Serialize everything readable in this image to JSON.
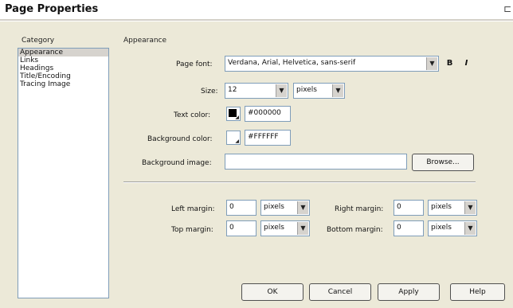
{
  "window": {
    "title": "Page Properties"
  },
  "category": {
    "header": "Category",
    "items": [
      {
        "label": "Appearance",
        "selected": true
      },
      {
        "label": "Links"
      },
      {
        "label": "Headings"
      },
      {
        "label": "Title/Encoding"
      },
      {
        "label": "Tracing Image"
      }
    ]
  },
  "appearance": {
    "header": "Appearance",
    "page_font": {
      "label": "Page font:",
      "value": "Verdana, Arial, Helvetica, sans-serif",
      "bold": "B",
      "italic": "I"
    },
    "size": {
      "label": "Size:",
      "value": "12",
      "unit": "pixels"
    },
    "text_color": {
      "label": "Text color:",
      "value": "#000000",
      "swatch": "#000000"
    },
    "background_color": {
      "label": "Background color:",
      "value": "#FFFFFF",
      "swatch": "#FFFFFF"
    },
    "background_image": {
      "label": "Background image:",
      "value": "",
      "browse": "Browse..."
    },
    "left_margin": {
      "label": "Left margin:",
      "value": "0",
      "unit": "pixels"
    },
    "right_margin": {
      "label": "Right margin:",
      "value": "0",
      "unit": "pixels"
    },
    "top_margin": {
      "label": "Top margin:",
      "value": "0",
      "unit": "pixels"
    },
    "bottom_margin": {
      "label": "Bottom margin:",
      "value": "0",
      "unit": "pixels"
    }
  },
  "buttons": {
    "ok": "OK",
    "cancel": "Cancel",
    "apply": "Apply",
    "help": "Help"
  }
}
